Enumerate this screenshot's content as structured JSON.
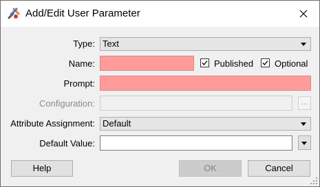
{
  "window": {
    "title": "Add/Edit User Parameter"
  },
  "form": {
    "type_label": "Type:",
    "type_value": "Text",
    "name_label": "Name:",
    "name_value": "",
    "published_label": "Published",
    "published_checked": true,
    "optional_label": "Optional",
    "optional_checked": true,
    "prompt_label": "Prompt:",
    "prompt_value": "",
    "configuration_label": "Configuration:",
    "configuration_button": "...",
    "attribute_label": "Attribute Assignment:",
    "attribute_value": "Default",
    "default_label": "Default Value:",
    "default_value": ""
  },
  "buttons": {
    "help": "Help",
    "ok": "OK",
    "cancel": "Cancel"
  },
  "colors": {
    "required_field": "#ff9b9b"
  }
}
